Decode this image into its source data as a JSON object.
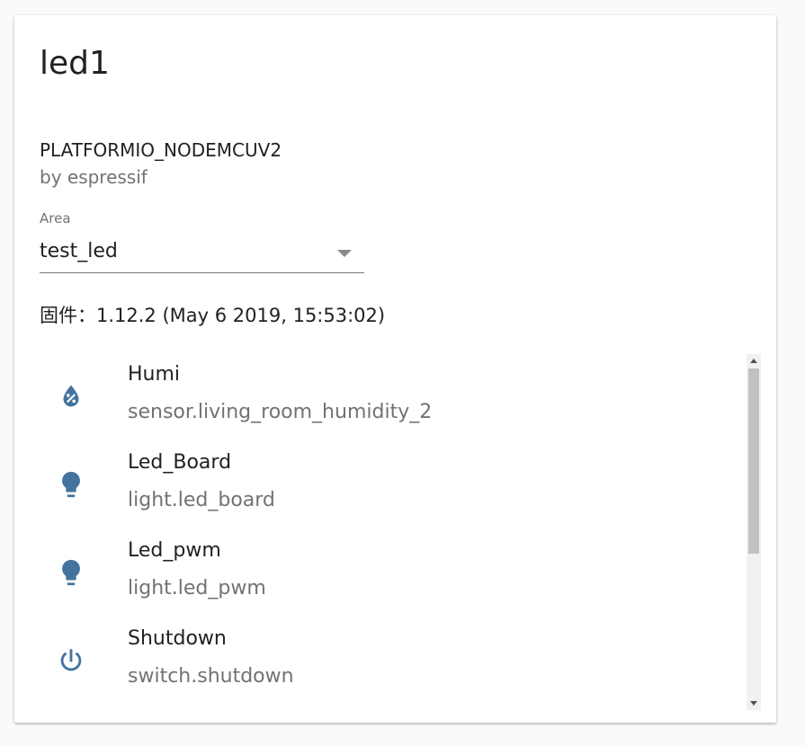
{
  "device": {
    "name": "led1",
    "model": "PLATFORMIO_NODEMCUV2",
    "manufacturer": "by espressif",
    "firmware": "固件：1.12.2 (May 6 2019, 15:53:02)"
  },
  "area": {
    "label": "Area",
    "value": "test_led"
  },
  "entities": [
    {
      "name": "Humi",
      "entity_id": "sensor.living_room_humidity_2",
      "icon": "water-percent-icon"
    },
    {
      "name": "Led_Board",
      "entity_id": "light.led_board",
      "icon": "lightbulb-icon"
    },
    {
      "name": "Led_pwm",
      "entity_id": "light.led_pwm",
      "icon": "lightbulb-icon"
    },
    {
      "name": "Shutdown",
      "entity_id": "switch.shutdown",
      "icon": "power-icon"
    }
  ],
  "colors": {
    "icon": "#44739e",
    "primary_text": "#212121",
    "secondary_text": "#727272"
  }
}
